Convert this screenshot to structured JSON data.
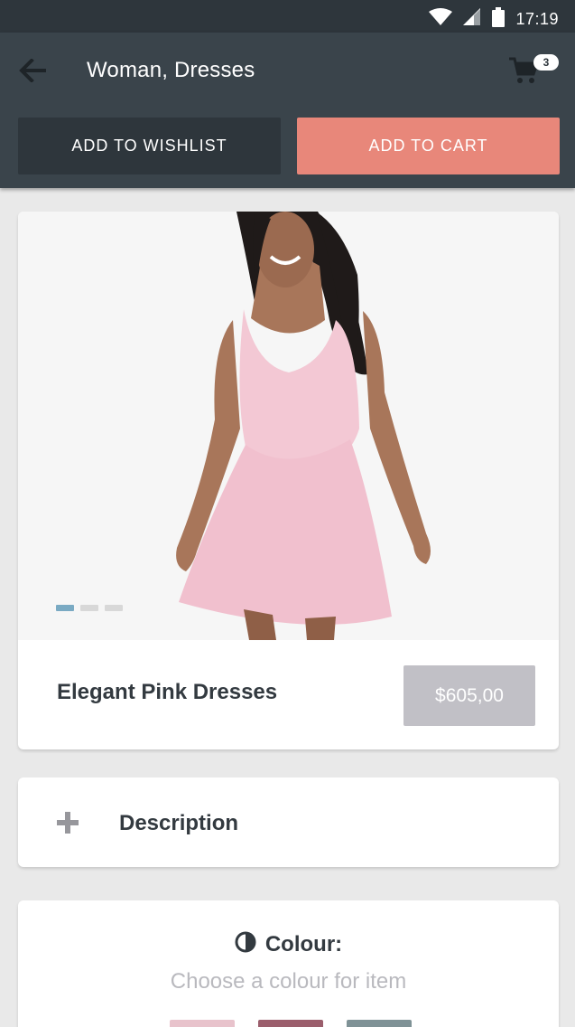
{
  "status_bar": {
    "time": "17:19",
    "icons": [
      "wifi-icon",
      "signal-icon",
      "battery-icon"
    ]
  },
  "app_bar": {
    "title": "Woman, Dresses",
    "cart_count": "3"
  },
  "actions": {
    "wishlist_label": "ADD TO WISHLIST",
    "cart_label": "ADD TO CART"
  },
  "product": {
    "name": "Elegant Pink Dresses",
    "price": "$605,00",
    "image_count": 3,
    "active_image": 1
  },
  "description": {
    "label": "Description"
  },
  "colour": {
    "title": "Colour:",
    "subtitle": "Choose a colour for item",
    "swatches": [
      "#e8c3cc",
      "#9b5e6c",
      "#7f9296"
    ]
  },
  "colors": {
    "status_bar": "#2e363c",
    "app_bar": "#3a444b",
    "wishlist_button": "#2e363c",
    "cart_button": "#e8877a",
    "price_tag": "#c1c0c6",
    "dot_active": "#7aaac3",
    "background": "#e9e9e9"
  }
}
